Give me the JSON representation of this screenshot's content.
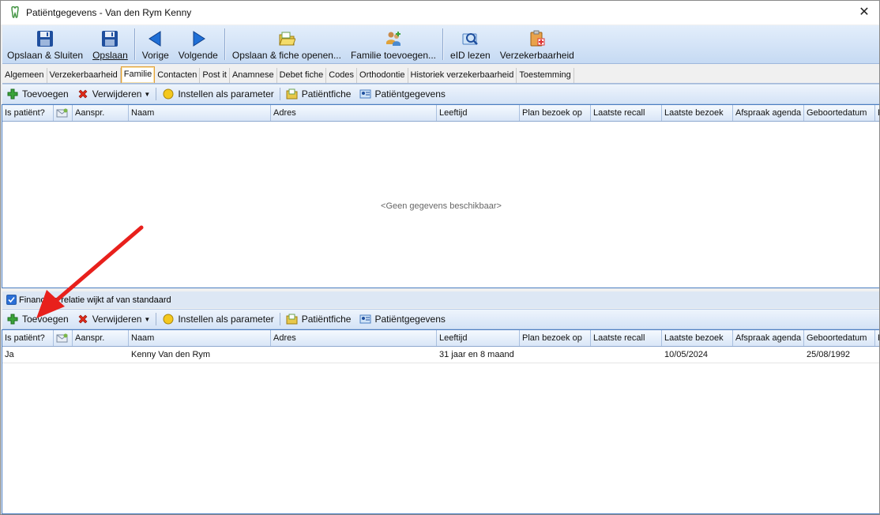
{
  "window": {
    "title": "Patiëntgegevens - Van den Rym Kenny",
    "close_label": "✕"
  },
  "main_toolbar": {
    "save_close": "Opslaan & Sluiten",
    "save": "Opslaan",
    "previous": "Vorige",
    "next": "Volgende",
    "save_open_file": "Opslaan & fiche openen...",
    "add_family": "Familie toevoegen...",
    "read_eid": "eID lezen",
    "insurance": "Verzekerbaarheid"
  },
  "tabs": [
    {
      "label": "Algemeen"
    },
    {
      "label": "Verzekerbaarheid"
    },
    {
      "label": "Familie"
    },
    {
      "label": "Contacten"
    },
    {
      "label": "Post it"
    },
    {
      "label": "Anamnese"
    },
    {
      "label": "Debet fiche"
    },
    {
      "label": "Codes"
    },
    {
      "label": "Orthodontie"
    },
    {
      "label": "Historiek verzekerbaarheid"
    },
    {
      "label": "Toestemming"
    }
  ],
  "sub_toolbar": {
    "add": "Toevoegen",
    "delete": "Verwijderen",
    "set_parameter": "Instellen als parameter",
    "patient_file": "Patiëntfiche",
    "patient_data": "Patiëntgegevens"
  },
  "columns": [
    {
      "label": "Is patiënt?"
    },
    {
      "label": ""
    },
    {
      "label": "Aanspr."
    },
    {
      "label": "Naam"
    },
    {
      "label": "Adres"
    },
    {
      "label": "Leeftijd"
    },
    {
      "label": "Plan bezoek op"
    },
    {
      "label": "Laatste recall"
    },
    {
      "label": "Laatste bezoek"
    },
    {
      "label": "Afspraak agenda"
    },
    {
      "label": "Geboortedatum"
    },
    {
      "label": "F"
    }
  ],
  "top_grid": {
    "empty_message": "<Geen gegevens beschikbaar>"
  },
  "financial_checkbox": {
    "label": "Financiële relatie wijkt af van standaard",
    "checked": true
  },
  "bottom_grid": {
    "rows": [
      {
        "is_patient": "Ja",
        "icon": "",
        "salutation": "",
        "name": "Kenny Van den Rym",
        "address": "",
        "age": "31 jaar en 8 maand",
        "planned_visit": "",
        "last_recall": "",
        "last_visit": "10/05/2024",
        "appointment": "",
        "birth_date": "25/08/1992",
        "extra": ""
      }
    ]
  },
  "colors": {
    "accent": "#2b6fd6",
    "toolbar_top": "#e3eefb",
    "toolbar_bottom": "#c6daf3",
    "arrow": "#e8201c"
  }
}
